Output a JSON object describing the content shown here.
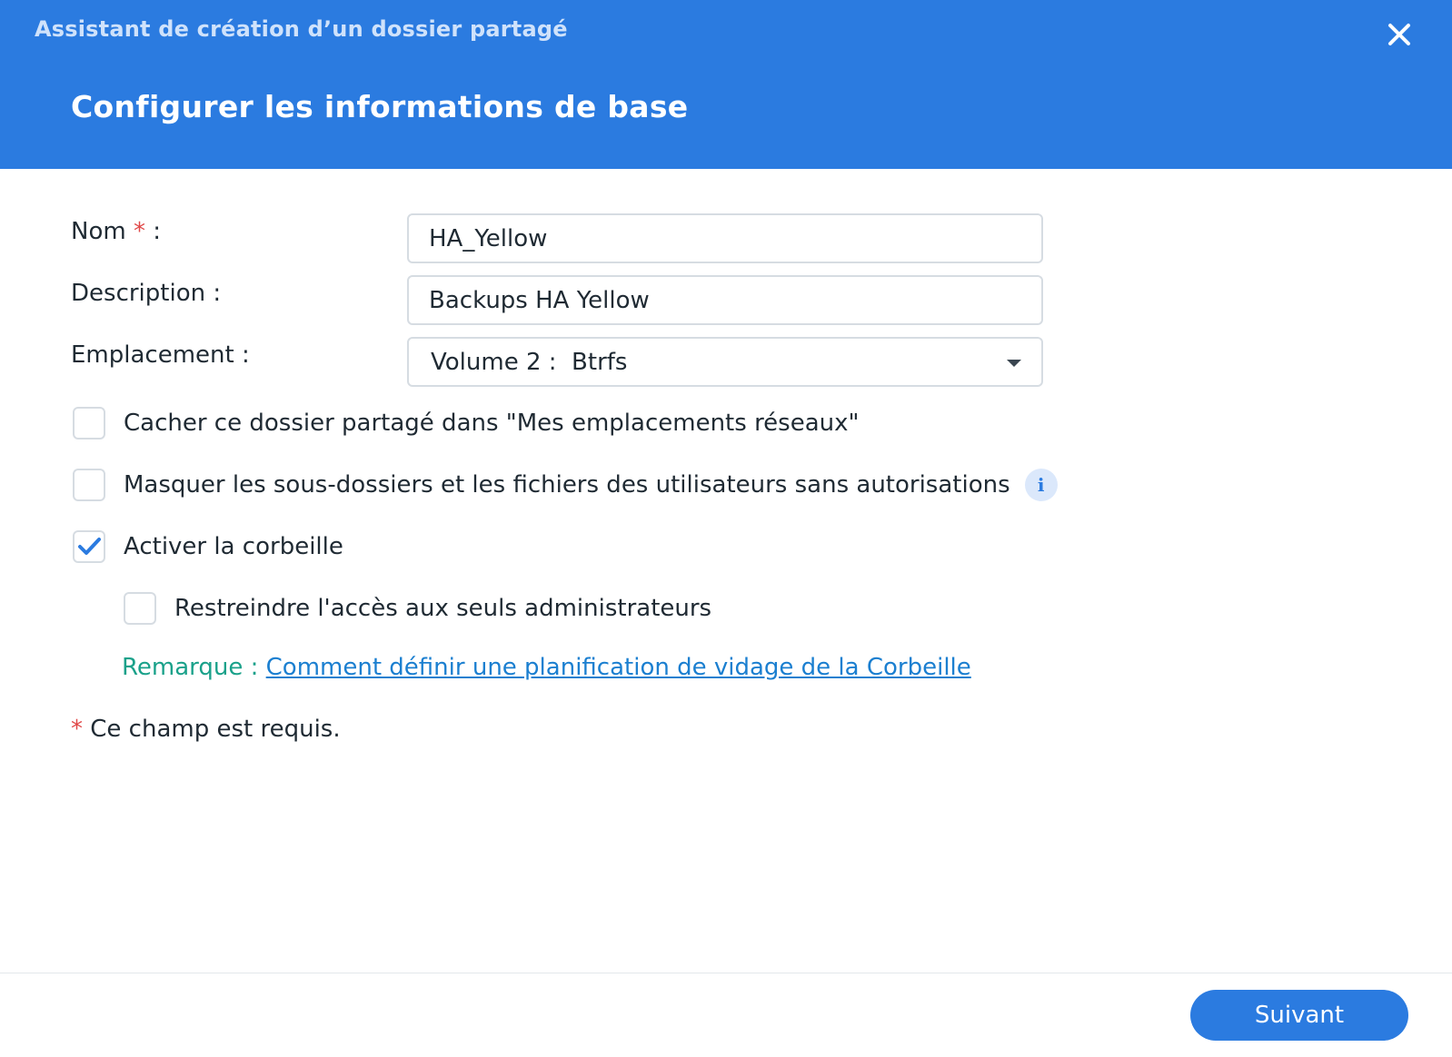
{
  "window": {
    "title": "Assistant de création d’un dossier partagé",
    "close_icon": "close-icon"
  },
  "step": {
    "title": "Configurer les informations de base"
  },
  "form": {
    "name": {
      "label": "Nom",
      "required_mark": "*",
      "colon": ":",
      "value": "HA_Yellow"
    },
    "description": {
      "label": "Description :",
      "value": "Backups HA Yellow"
    },
    "location": {
      "label": "Emplacement :",
      "value": "Volume 2 :  Btrfs",
      "arrow_icon": "dropdown-arrow-icon"
    }
  },
  "options": {
    "hide_folder": {
      "label": "Cacher ce dossier partagé dans \"Mes emplacements réseaux\"",
      "checked": false
    },
    "hide_subfolders": {
      "label": "Masquer les sous-dossiers et les fichiers des utilisateurs sans autorisations",
      "checked": false,
      "info_icon": "info-icon",
      "info_glyph": "i"
    },
    "recycle_bin": {
      "label": "Activer la corbeille",
      "checked": true
    },
    "admin_only": {
      "label": "Restreindre l'accès aux seuls administrateurs",
      "checked": false
    }
  },
  "note": {
    "label": "Remarque :",
    "link": "Comment définir une planification de vidage de la Corbeille"
  },
  "required_note": {
    "star": "*",
    "text": "Ce champ est requis."
  },
  "footer": {
    "next_label": "Suivant"
  },
  "colors": {
    "header_bg": "#2b7be0",
    "accent": "#2b7be0",
    "required": "#e04848",
    "note_label": "#1aa18a",
    "link": "#1b7fd0"
  }
}
